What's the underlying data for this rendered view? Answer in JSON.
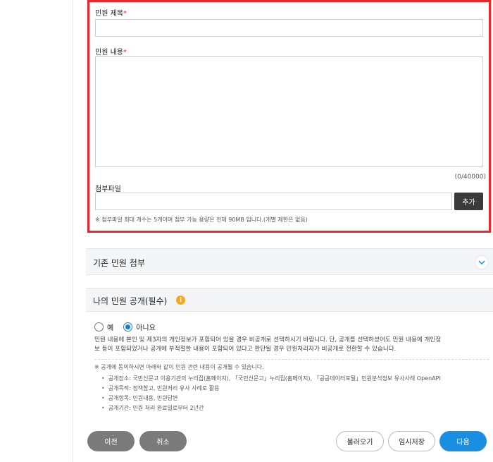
{
  "form": {
    "title_label": "민원 제목",
    "content_label": "민원 내용",
    "required_mark": "*",
    "counter": "(0/40000)",
    "attachment_label": "첨부파일",
    "add_button": "추가",
    "attachment_note": "※ 첨부파일 최대 개수는 5개이며 첨부 가능 용량은 전체 90MB 입니다.(개별 제한은 없음)"
  },
  "existing_attach": {
    "title": "기존 민원 첨부",
    "toggle_icon": "chevron-down-icon"
  },
  "disclosure": {
    "title": "나의 민원 공개(필수)",
    "info_icon": "info-icon",
    "options": [
      {
        "label": "예",
        "selected": false
      },
      {
        "label": "아니요",
        "selected": true
      }
    ],
    "description_line1": "민원 내용에 본인 및 제3자의 개인정보가 포함되어 있을 경우 비공개로 선택하시기 바랍니다. 단, 공개를 선택하셨어도 민원 내용에 개인정",
    "description_line2": "보 등이 포함되었거나 공개에 부적절한 내용이 포함되어 있다고 판단될 경우 민원처리자가 비공개로 전환할 수 있습니다.",
    "notice": "※ 공개에 동의하시면 아래와 같이 민원 관련 내용이 공개될 수 있습니다.",
    "items": [
      "공개장소: 국민신문고 이용기관의 누리집(홈페이지), 「국민신문고」누리집(홈페이지), 「공공데이터포털」민원분석정보 유사사례 OpenAPI",
      "공개목적: 정책참고, 민원처리 유사 사례로 활용",
      "공개항목: 민원내용, 민원답변",
      "공개기간: 민원 처리 완료일로부터 2년간"
    ]
  },
  "buttons": {
    "prev": "이전",
    "cancel": "취소",
    "load": "불러오기",
    "temp_save": "임시저장",
    "next": "다음"
  },
  "colors": {
    "highlight_border": "#e8262b",
    "accent_blue": "#1a8ee0",
    "info_orange": "#f5a623"
  }
}
